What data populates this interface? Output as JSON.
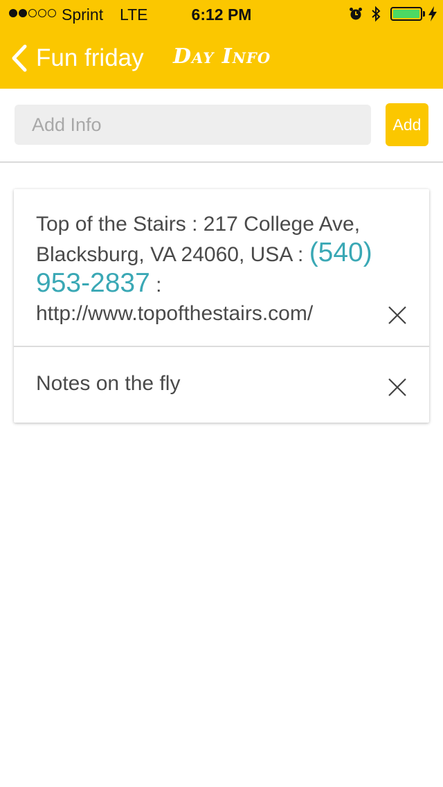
{
  "status_bar": {
    "carrier": "Sprint",
    "network": "LTE",
    "time": "6:12 PM",
    "signal_bars_filled": 2,
    "signal_bars_total": 5,
    "battery_level": 1.0,
    "battery_color": "#4cd964",
    "icons": [
      "alarm-icon",
      "bluetooth-icon",
      "battery-icon",
      "charging-bolt-icon"
    ]
  },
  "nav": {
    "back_label": "Fun friday",
    "title": "Day Info",
    "background": "#fbc700"
  },
  "add_row": {
    "placeholder": "Add Info",
    "value": "",
    "button_label": "Add"
  },
  "items": [
    {
      "text_before": "Top of the Stairs : 217 College Ave, Blacksburg, VA 24060, USA : ",
      "phone": "(540) 953-2837",
      "text_after": " : http://www.topofthestairs.com/",
      "delete_icon": "close-icon"
    },
    {
      "text": "Notes on the fly",
      "delete_icon": "close-icon"
    }
  ],
  "colors": {
    "accent": "#fbc700",
    "link": "#3aa8b5",
    "text": "#4a4a4a"
  }
}
